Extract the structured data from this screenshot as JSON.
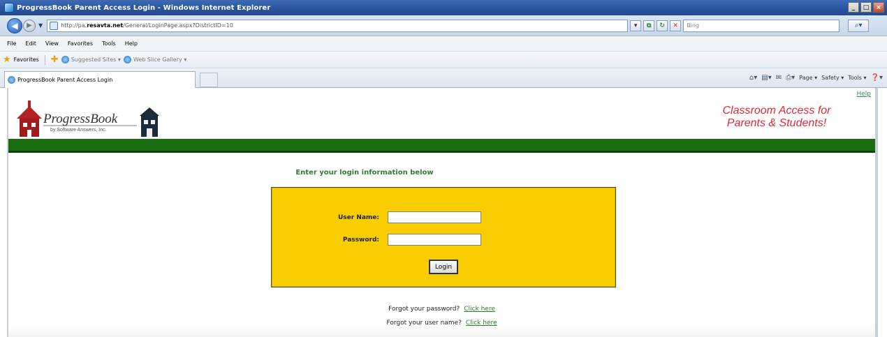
{
  "window": {
    "title": "ProgressBook Parent Access Login - Windows Internet Explorer",
    "min_label": "_",
    "max_label": "□",
    "close_label": "×"
  },
  "addressbar": {
    "url_prefix": "http://pa.",
    "url_domain": "resavta.net",
    "url_path": "/General/LoginPage.aspx?DistrictID=10",
    "search_placeholder": "Bing"
  },
  "menu": [
    "File",
    "Edit",
    "View",
    "Favorites",
    "Tools",
    "Help"
  ],
  "favorites": {
    "label": "Favorites",
    "items": [
      "Suggested Sites ▾",
      "Web Slice Gallery ▾"
    ]
  },
  "tab": {
    "label": "ProgressBook Parent Access Login"
  },
  "commandbar": {
    "page": "Page ▾",
    "safety": "Safety ▾",
    "tools": "Tools ▾"
  },
  "page": {
    "help": "Help",
    "logo_main": "ProgressBook",
    "logo_sub": "by Software Answers, Inc.",
    "tagline_line1": "Classroom Access for",
    "tagline_line2": "Parents & Students!",
    "instructions": "Enter your login information below",
    "username_label": "User Name:",
    "password_label": "Password:",
    "username_value": "",
    "password_value": "",
    "login_button": "Login",
    "forgot_password_text": "Forgot your password?",
    "forgot_password_link": "Click here",
    "forgot_username_text": "Forgot your user name?",
    "forgot_username_link": "Click here"
  },
  "colors": {
    "login_box": "#f8cd02",
    "green_band": "#1b6b11",
    "tagline": "#e0283e",
    "link_green": "#2e7d32"
  }
}
